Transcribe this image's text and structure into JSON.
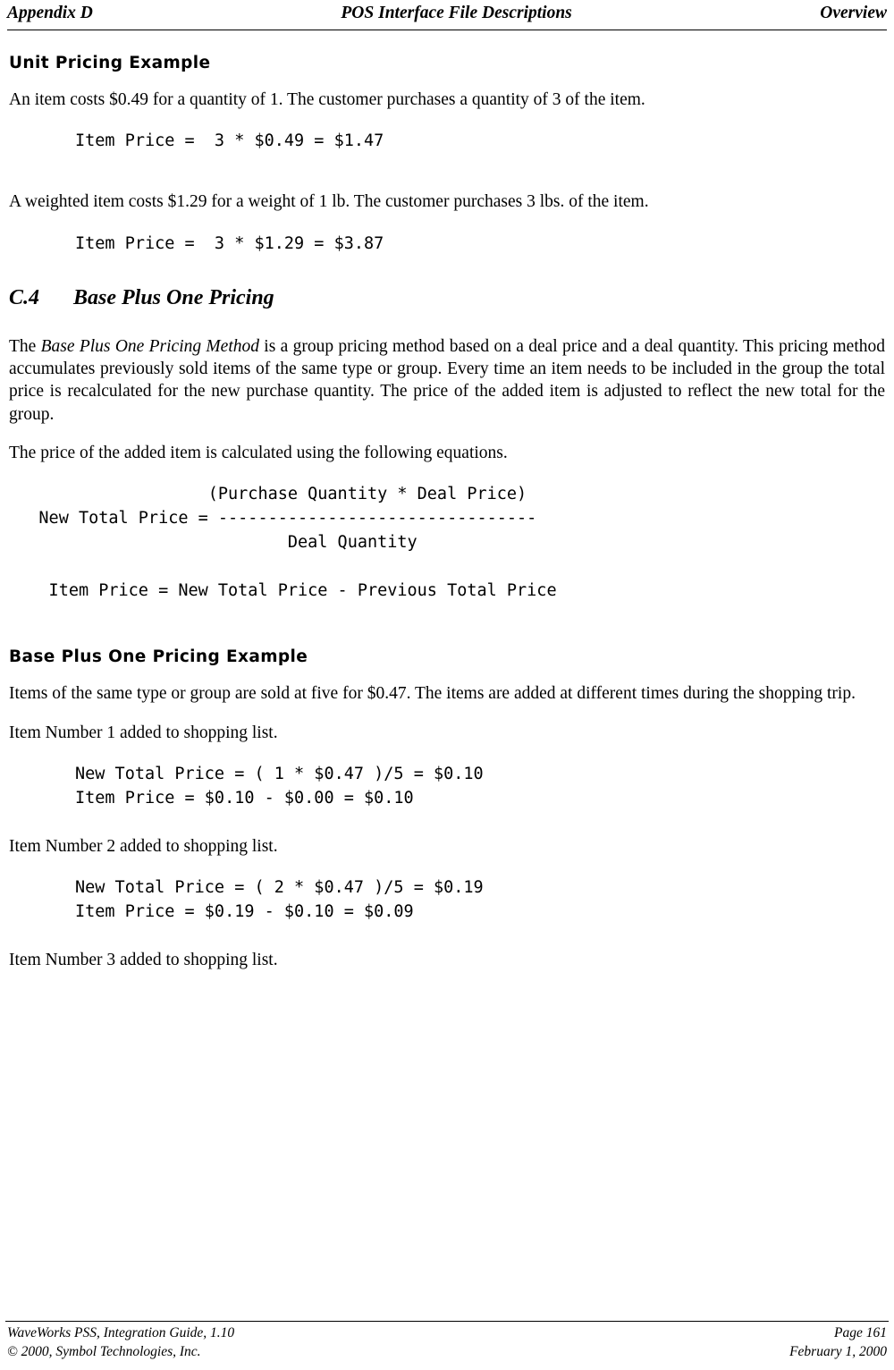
{
  "header": {
    "left": "Appendix D",
    "center": "POS Interface File Descriptions",
    "right": "Overview"
  },
  "content": {
    "unit_pricing_heading": "Unit Pricing Example",
    "unit_pricing_para1": "An item costs $0.49 for a quantity of 1.  The customer purchases a quantity of 3 of the item.",
    "unit_pricing_code1": "Item Price =  3 * $0.49 = $1.47",
    "unit_pricing_para2": "A weighted item costs $1.29 for a weight of 1 lb.  The customer purchases 3 lbs. of the item.",
    "unit_pricing_code2": "Item Price =  3 * $1.29 = $3.87",
    "section_number": "C.4",
    "section_title": "Base Plus One Pricing",
    "base_para1": "The Base Plus One Pricing Method is a group pricing method based on a deal price and a deal quantity.  This pricing method accumulates previously sold items of the same type or group.  Every time an item needs to be included in the group the total price is recalculated for the new purchase quantity.  The price of the added item is adjusted to reflect the new total for the group.",
    "base_para1_italic_run": "Base Plus One Pricing Method",
    "base_para2": "The price of the added item is calculated using the following equations.",
    "formula_block": "                    (Purchase Quantity * Deal Price)\n   New Total Price = --------------------------------\n                            Deal Quantity\n\n    Item Price = New Total Price - Previous Total Price",
    "example_heading": "Base Plus One Pricing Example",
    "example_para1": "Items of the same type or group are sold at five for $0.47.  The items are added at different times during the shopping trip.",
    "item1_para": "Item Number 1 added to shopping list.",
    "item1_code": "New Total Price = ( 1 * $0.47 )/5 = $0.10\nItem Price = $0.10 - $0.00 = $0.10",
    "item2_para": "Item Number 2 added to shopping list.",
    "item2_code": "New Total Price = ( 2 * $0.47 )/5 = $0.19\nItem Price = $0.19 - $0.10 = $0.09",
    "item3_para": "Item Number 3 added to shopping list."
  },
  "footer": {
    "left_line1": "WaveWorks PSS, Integration Guide, 1.10",
    "left_line2": "© 2000, Symbol Technologies, Inc.",
    "right_line1": "Page 161",
    "right_line2": "February 1, 2000"
  }
}
